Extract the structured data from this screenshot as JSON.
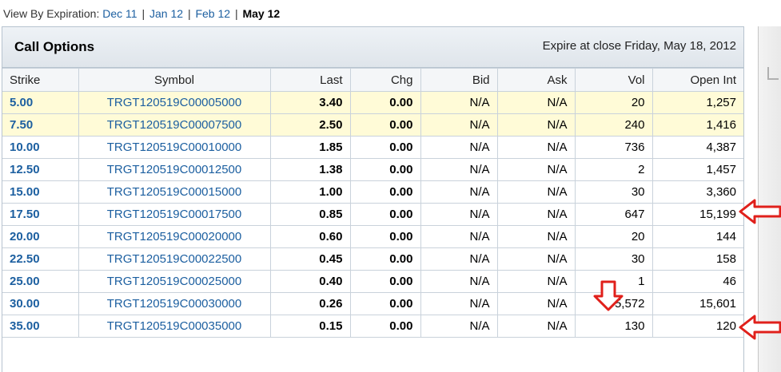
{
  "expiration_nav": {
    "label": "View By Expiration:",
    "links": [
      "Dec 11",
      "Jan 12",
      "Feb 12"
    ],
    "separator": "|",
    "current": "May 12"
  },
  "panel": {
    "title": "Call Options",
    "expire_text": "Expire at close Friday, May 18, 2012"
  },
  "columns": [
    "Strike",
    "Symbol",
    "Last",
    "Chg",
    "Bid",
    "Ask",
    "Vol",
    "Open Int"
  ],
  "rows": [
    {
      "strike": "5.00",
      "symbol": "TRGT120519C00005000",
      "last": "3.40",
      "chg": "0.00",
      "bid": "N/A",
      "ask": "N/A",
      "vol": "20",
      "open_int": "1,257",
      "in_the_money": true
    },
    {
      "strike": "7.50",
      "symbol": "TRGT120519C00007500",
      "last": "2.50",
      "chg": "0.00",
      "bid": "N/A",
      "ask": "N/A",
      "vol": "240",
      "open_int": "1,416",
      "in_the_money": true
    },
    {
      "strike": "10.00",
      "symbol": "TRGT120519C00010000",
      "last": "1.85",
      "chg": "0.00",
      "bid": "N/A",
      "ask": "N/A",
      "vol": "736",
      "open_int": "4,387",
      "in_the_money": false
    },
    {
      "strike": "12.50",
      "symbol": "TRGT120519C00012500",
      "last": "1.38",
      "chg": "0.00",
      "bid": "N/A",
      "ask": "N/A",
      "vol": "2",
      "open_int": "1,457",
      "in_the_money": false
    },
    {
      "strike": "15.00",
      "symbol": "TRGT120519C00015000",
      "last": "1.00",
      "chg": "0.00",
      "bid": "N/A",
      "ask": "N/A",
      "vol": "30",
      "open_int": "3,360",
      "in_the_money": false
    },
    {
      "strike": "17.50",
      "symbol": "TRGT120519C00017500",
      "last": "0.85",
      "chg": "0.00",
      "bid": "N/A",
      "ask": "N/A",
      "vol": "647",
      "open_int": "15,199",
      "in_the_money": false
    },
    {
      "strike": "20.00",
      "symbol": "TRGT120519C00020000",
      "last": "0.60",
      "chg": "0.00",
      "bid": "N/A",
      "ask": "N/A",
      "vol": "20",
      "open_int": "144",
      "in_the_money": false
    },
    {
      "strike": "22.50",
      "symbol": "TRGT120519C00022500",
      "last": "0.45",
      "chg": "0.00",
      "bid": "N/A",
      "ask": "N/A",
      "vol": "30",
      "open_int": "158",
      "in_the_money": false
    },
    {
      "strike": "25.00",
      "symbol": "TRGT120519C00025000",
      "last": "0.40",
      "chg": "0.00",
      "bid": "N/A",
      "ask": "N/A",
      "vol": "1",
      "open_int": "46",
      "in_the_money": false
    },
    {
      "strike": "30.00",
      "symbol": "TRGT120519C00030000",
      "last": "0.26",
      "chg": "0.00",
      "bid": "N/A",
      "ask": "N/A",
      "vol": "5,572",
      "open_int": "15,601",
      "in_the_money": false
    },
    {
      "strike": "35.00",
      "symbol": "TRGT120519C00035000",
      "last": "0.15",
      "chg": "0.00",
      "bid": "N/A",
      "ask": "N/A",
      "vol": "130",
      "open_int": "120",
      "in_the_money": false
    }
  ],
  "colors": {
    "link": "#1c5fa0",
    "itm_row_background": "#fffbd7",
    "annotation_arrow": "#e0201b"
  },
  "annotations": [
    {
      "type": "arrow-left",
      "target_row": "17.50",
      "target_column": "Open Int"
    },
    {
      "type": "arrow-down",
      "target_row": "25.00",
      "target_column": "Vol"
    },
    {
      "type": "arrow-left",
      "target_row": "30.00",
      "target_column": "Open Int"
    }
  ]
}
